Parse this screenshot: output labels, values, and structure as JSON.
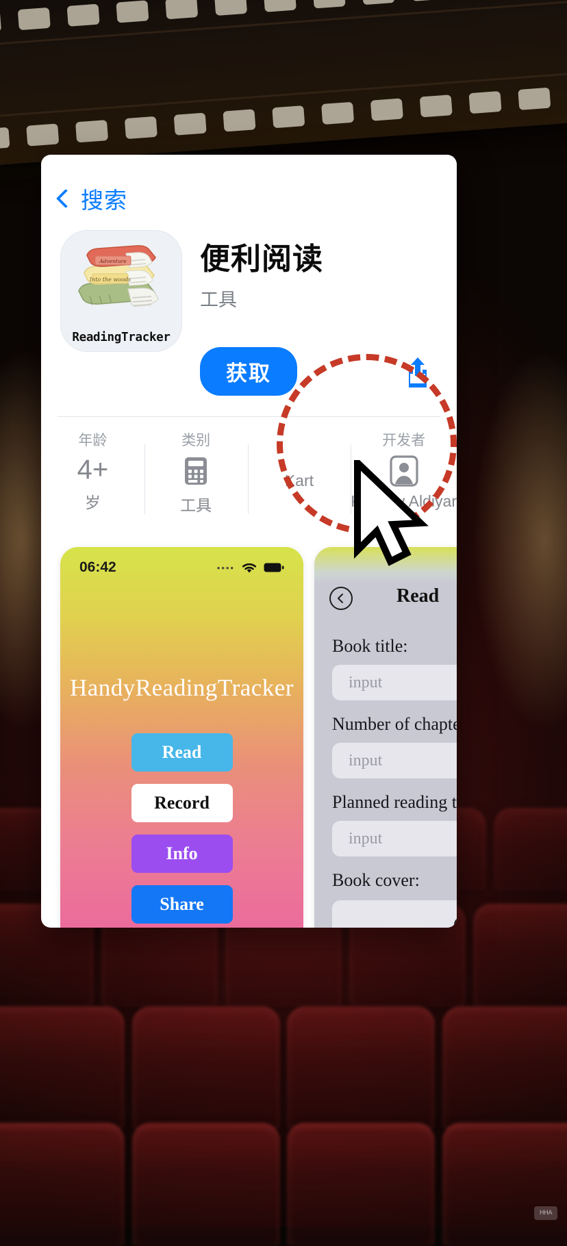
{
  "background": {
    "scene": "cinema-seats-filmstrip",
    "watermark": "HHA"
  },
  "card": {
    "back_nav": {
      "icon": "chevron-left-icon",
      "label": "搜索"
    },
    "app": {
      "icon_label": "ReadingTracker",
      "title": "便利阅读",
      "subtitle": "工具",
      "get_button": "获取",
      "share_icon": "share-icon"
    },
    "info": [
      {
        "key": "年龄",
        "big": "4+",
        "value": "岁",
        "glyph": ""
      },
      {
        "key": "类别",
        "big": "",
        "value": "工具",
        "glyph": "calculator-icon"
      },
      {
        "key": "",
        "big": "",
        "value": "Kart",
        "glyph": ""
      },
      {
        "key": "开发者",
        "big": "",
        "value": "Kartpay Aldiyar",
        "glyph": "person-card-icon"
      }
    ],
    "screenshots": [
      {
        "name": "home-screen",
        "status_time": "06:42",
        "status_icons": [
          "cellular-dots",
          "wifi-icon",
          "battery-icon"
        ],
        "app_title": "HandyReadingTracker",
        "buttons": [
          "Read",
          "Record",
          "Info",
          "Share"
        ]
      },
      {
        "name": "record-form-screen",
        "back_icon": "chevron-left-circle-icon",
        "header": "Read",
        "fields": [
          {
            "label": "Book title:",
            "placeholder": "input"
          },
          {
            "label": "Number of chapters read:",
            "placeholder": "input"
          },
          {
            "label": "Planned reading time(hours):",
            "placeholder": "input"
          }
        ],
        "cover_label": "Book cover:",
        "cover_icon": "image-placeholder-icon"
      }
    ]
  },
  "annotation": {
    "highlight_shape": "dashed-circle",
    "highlight_color": "#c63a27",
    "highlight_target": "开发者 Kartpay Aldiyar",
    "cursor": "arrow-cursor"
  }
}
